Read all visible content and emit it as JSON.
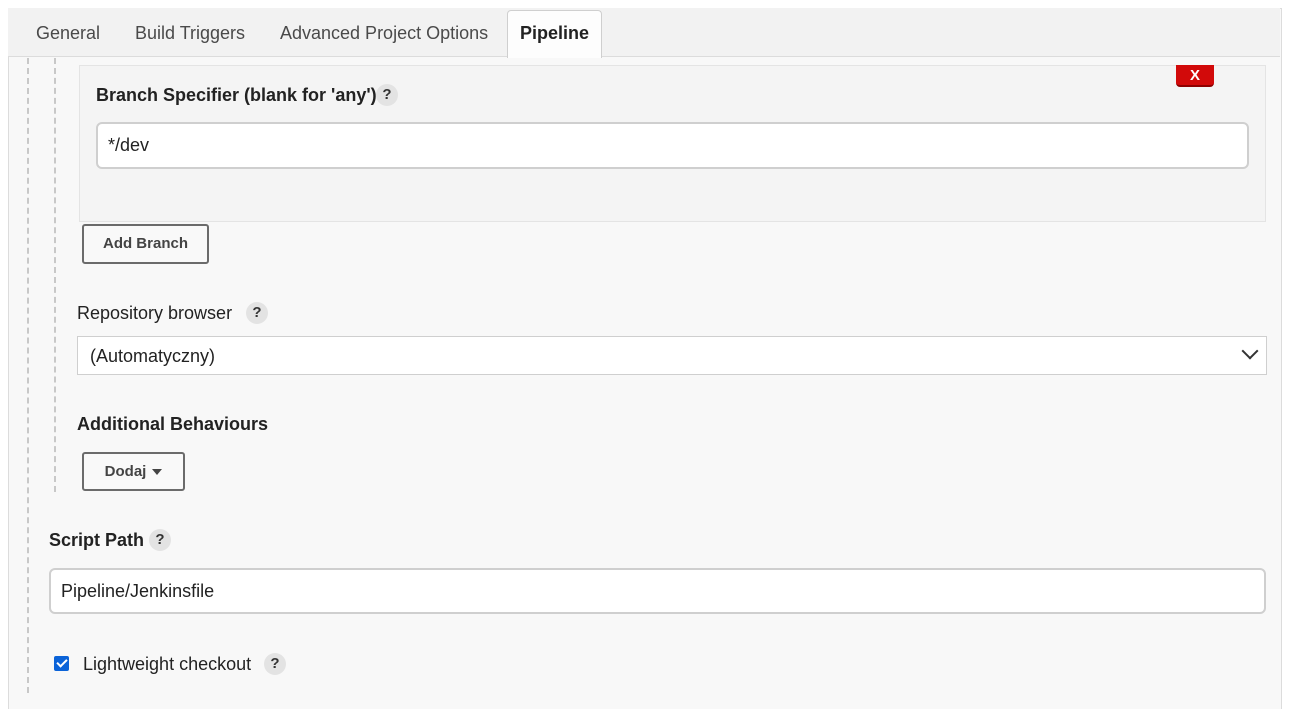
{
  "tabs": [
    {
      "label": "General"
    },
    {
      "label": "Build Triggers"
    },
    {
      "label": "Advanced Project Options"
    },
    {
      "label": "Pipeline",
      "active": true
    }
  ],
  "branch": {
    "delete_label": "X",
    "specifier_label": "Branch Specifier (blank for 'any')",
    "specifier_value": "*/dev",
    "add_branch_label": "Add Branch"
  },
  "repository_browser": {
    "label": "Repository browser",
    "selected": "(Automatyczny)"
  },
  "additional_behaviours": {
    "label": "Additional Behaviours",
    "add_label": "Dodaj"
  },
  "script_path": {
    "label": "Script Path",
    "value": "Pipeline/Jenkinsfile"
  },
  "lightweight_checkout": {
    "label": "Lightweight checkout",
    "checked": true
  },
  "help_glyph": "?",
  "colors": {
    "delete_red": "#d20a0a",
    "checkbox_blue": "#0b63d8"
  }
}
